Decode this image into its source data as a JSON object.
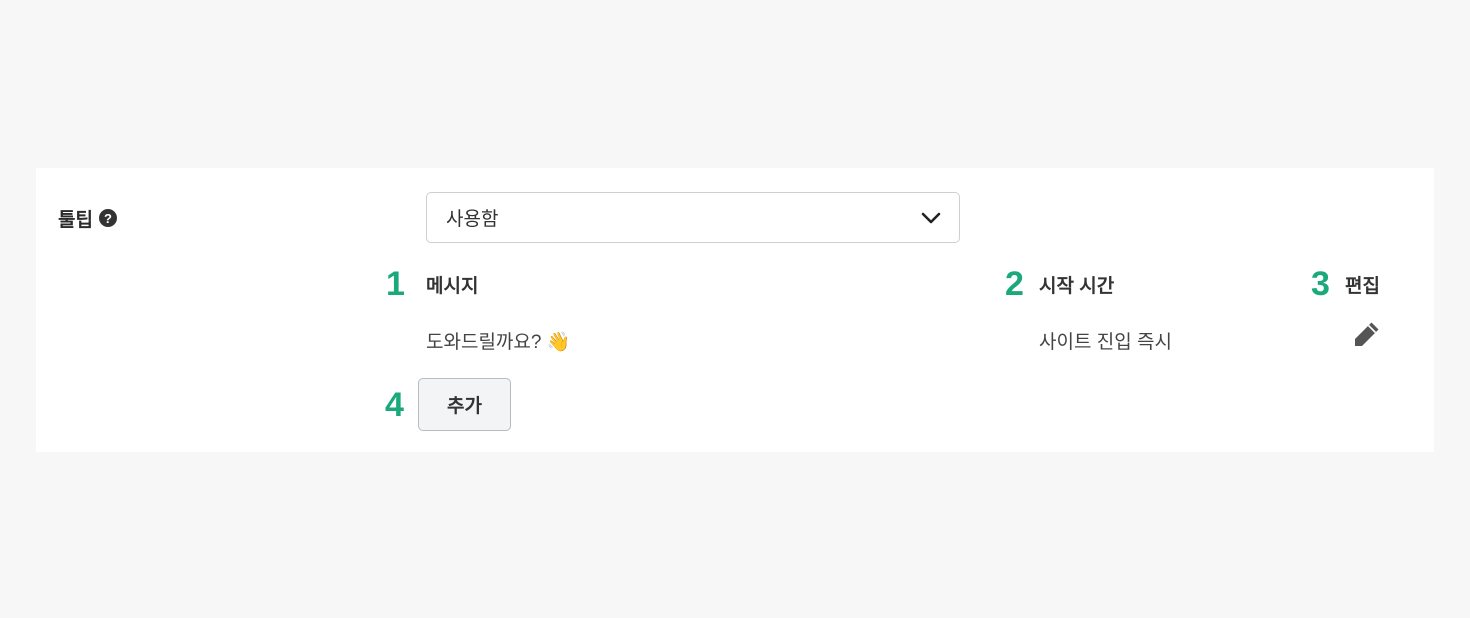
{
  "setting": {
    "label": "툴팁",
    "help_icon": "question-circle-icon",
    "help_glyph": "?"
  },
  "select": {
    "value": "사용함",
    "icon": "chevron-down-icon"
  },
  "markers": [
    "1",
    "2",
    "3",
    "4"
  ],
  "marker_color": "#1ba87a",
  "table": {
    "headers": {
      "message": "메시지",
      "start_time": "시작 시간",
      "edit": "편집"
    },
    "rows": [
      {
        "message": "도와드릴까요?",
        "emoji": "👋",
        "start_time": "사이트 진입 즉시",
        "edit_icon": "pencil-icon"
      }
    ]
  },
  "add_button": {
    "label": "추가"
  }
}
